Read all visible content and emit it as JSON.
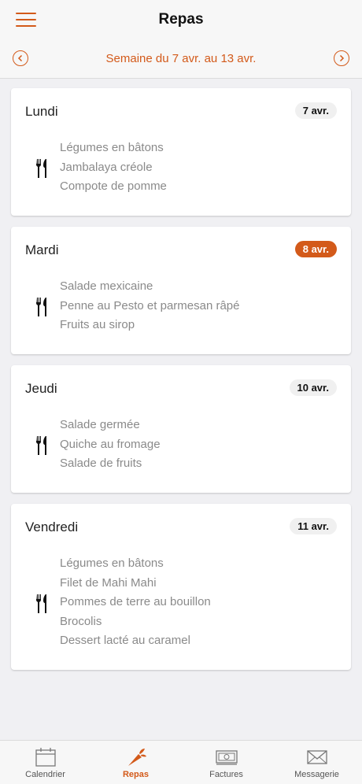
{
  "header": {
    "title": "Repas",
    "week_label": "Semaine du 7 avr. au 13 avr.",
    "accent_color": "#d35a1a"
  },
  "days": [
    {
      "name": "Lundi",
      "date": "7 avr.",
      "highlighted": false,
      "items": [
        "Légumes en bâtons",
        "Jambalaya créole",
        "Compote de pomme"
      ]
    },
    {
      "name": "Mardi",
      "date": "8 avr.",
      "highlighted": true,
      "items": [
        "Salade mexicaine",
        "Penne au Pesto et parmesan râpé",
        "Fruits au sirop"
      ]
    },
    {
      "name": "Jeudi",
      "date": "10 avr.",
      "highlighted": false,
      "items": [
        "Salade germée",
        "Quiche au fromage",
        "Salade de fruits"
      ]
    },
    {
      "name": "Vendredi",
      "date": "11 avr.",
      "highlighted": false,
      "items": [
        "Légumes en bâtons",
        "Filet de Mahi Mahi",
        "Pommes de terre au bouillon",
        "Brocolis",
        "Dessert lacté au caramel"
      ]
    }
  ],
  "tabs": [
    {
      "label": "Calendrier",
      "icon": "calendar-icon",
      "active": false
    },
    {
      "label": "Repas",
      "icon": "carrot-icon",
      "active": true
    },
    {
      "label": "Factures",
      "icon": "banknote-icon",
      "active": false
    },
    {
      "label": "Messagerie",
      "icon": "envelope-icon",
      "active": false
    }
  ]
}
